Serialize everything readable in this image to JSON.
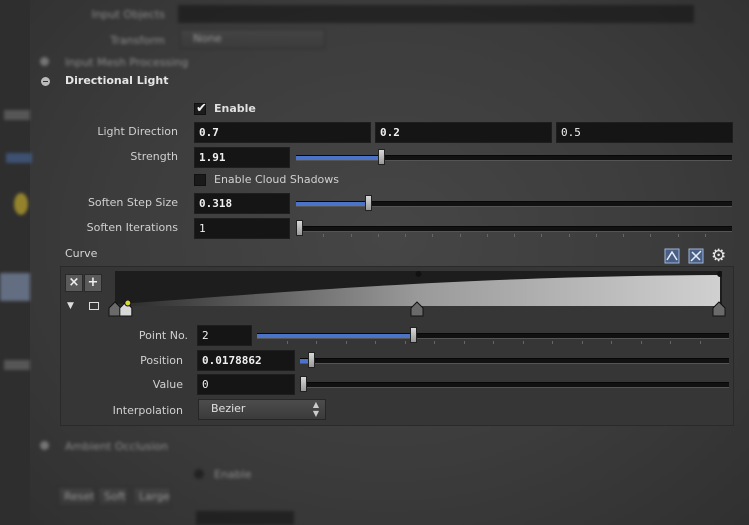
{
  "bg": {
    "top_title": "Input Objects",
    "transform_label": "Transform",
    "transform_value": "None",
    "section_above": "Input Mesh Processing",
    "section_below": "Ambient Occlusion",
    "enable_below": "Enable",
    "buttons_below": [
      "Reset",
      "Soft",
      "Large"
    ]
  },
  "directional_light": {
    "title": "Directional Light",
    "enable_label": "Enable",
    "enable_checked": true,
    "light_direction_label": "Light Direction",
    "light_direction": [
      "0.7",
      "0.2",
      "0.5"
    ],
    "strength_label": "Strength",
    "strength_value": "1.91",
    "strength_fraction": 0.19,
    "cloud_shadows_label": "Enable Cloud Shadows",
    "cloud_shadows_checked": false,
    "soften_step_label": "Soften Step Size",
    "soften_step_value": "0.318",
    "soften_step_fraction": 0.16,
    "soften_iter_label": "Soften Iterations",
    "soften_iter_value": "1",
    "soften_iter_fraction": 0.0
  },
  "curve": {
    "label": "Curve",
    "remove_glyph": "×",
    "add_glyph": "+",
    "point_no_label": "Point No.",
    "point_no_value": "2",
    "point_no_fraction": 0.33,
    "position_label": "Position",
    "position_value": "0.0178862",
    "position_fraction": 0.018,
    "value_label": "Value",
    "value_value": "0",
    "value_fraction": 0.0,
    "interpolation_label": "Interpolation",
    "interpolation_value": "Bezier",
    "points": [
      {
        "x": 0.0,
        "y": 0.0
      },
      {
        "x": 0.0179,
        "y": 0.0
      },
      {
        "x": 0.5,
        "y": 1.0
      },
      {
        "x": 1.0,
        "y": 1.0
      }
    ],
    "icons": [
      "curve-preset-icon",
      "curve-edit-icon",
      "gear-icon"
    ]
  }
}
